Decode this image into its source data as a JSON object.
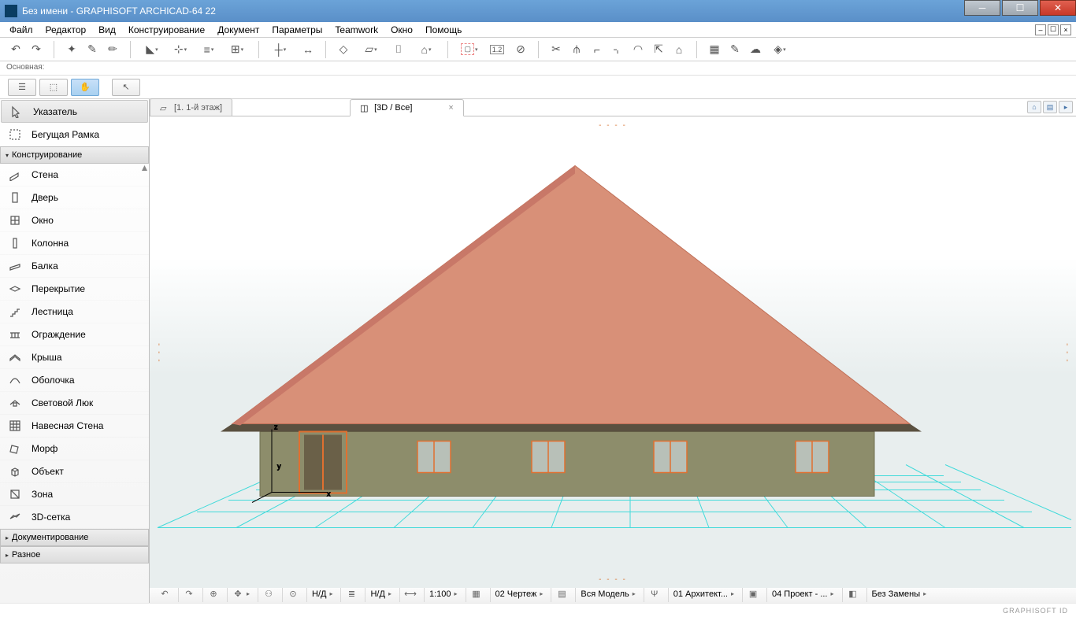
{
  "title": "Без имени - GRAPHISOFT ARCHICAD-64 22",
  "menu": [
    "Файл",
    "Редактор",
    "Вид",
    "Конструирование",
    "Документ",
    "Параметры",
    "Teamwork",
    "Окно",
    "Помощь"
  ],
  "info_label": "Основная:",
  "tabs": [
    {
      "label": "[1. 1-й этаж]",
      "active": false
    },
    {
      "label": "[3D / Все]",
      "active": true
    }
  ],
  "toolbox": {
    "pointer": "Указатель",
    "marquee": "Бегущая Рамка",
    "sections": {
      "design": "Конструирование",
      "document": "Документирование",
      "more": "Разное"
    },
    "design_tools": [
      "Стена",
      "Дверь",
      "Окно",
      "Колонна",
      "Балка",
      "Перекрытие",
      "Лестница",
      "Ограждение",
      "Крыша",
      "Оболочка",
      "Световой Люк",
      "Навесная Стена",
      "Морф",
      "Объект",
      "Зона",
      "3D-сетка"
    ]
  },
  "status": {
    "na1": "Н/Д",
    "na2": "Н/Д",
    "scale": "1:100",
    "layer": "02 Чертеж",
    "model": "Вся Модель",
    "arch": "01 Архитект...",
    "project": "04 Проект - ...",
    "replace": "Без Замены"
  },
  "footer_brand": "GRAPHISOFT ID"
}
